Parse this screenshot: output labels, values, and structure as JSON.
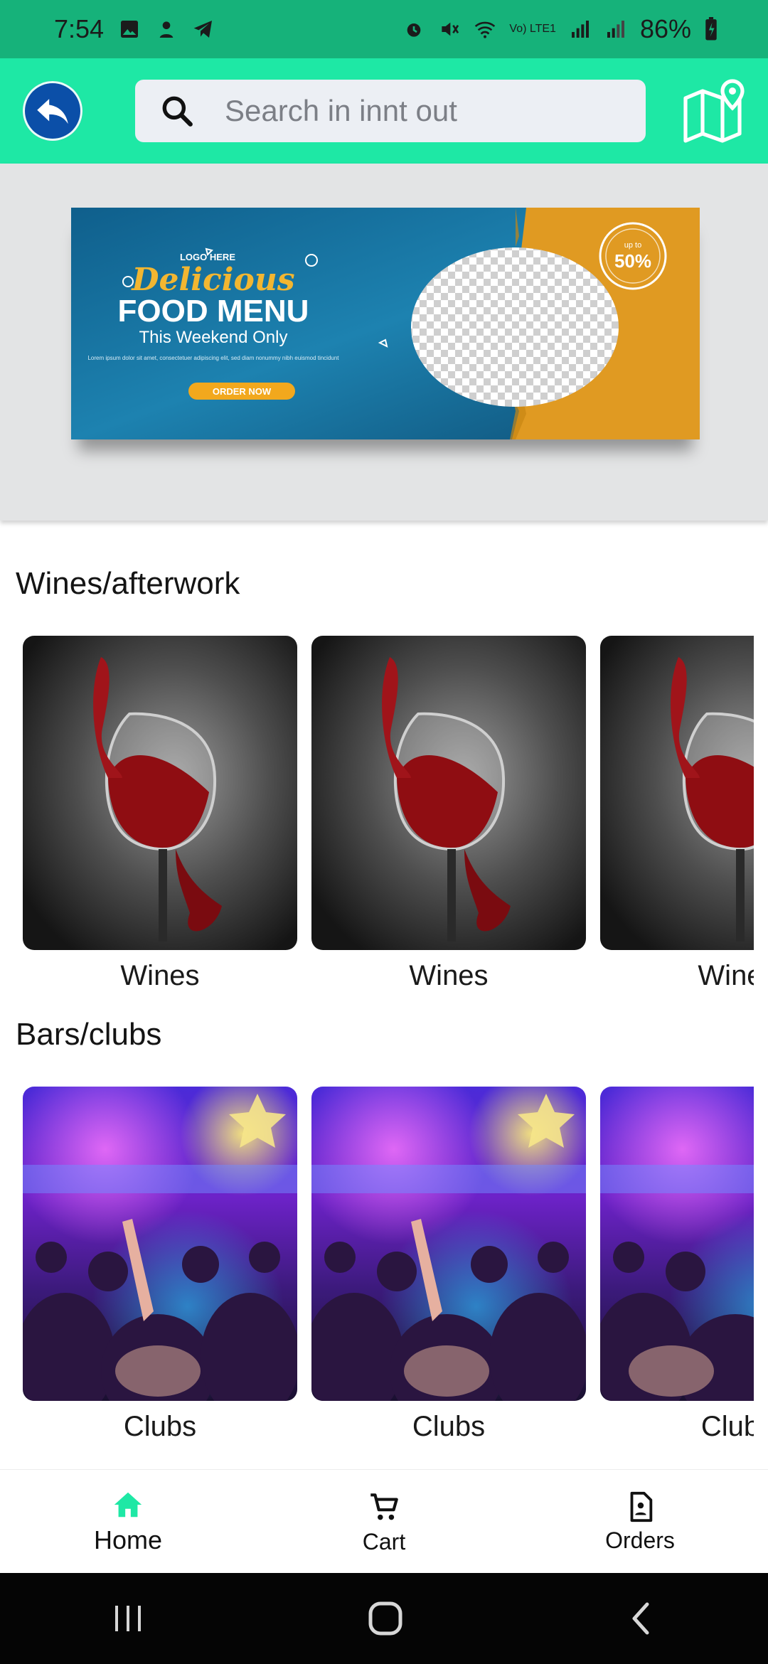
{
  "status_bar": {
    "time": "7:54",
    "network": "Vo) LTE1",
    "battery": "86%"
  },
  "header": {
    "search_placeholder": "Search in innt out"
  },
  "banner": {
    "logo_text": "LOGO HERE",
    "script_title": "Delicious",
    "title": "FOOD MENU",
    "subtitle": "This Weekend Only",
    "body": "Lorem ipsum dolor sit amet, consectetuer adipiscing elit, sed diam nonummy nibh euismod tincidunt",
    "cta": "ORDER NOW",
    "badge_top": "up to",
    "badge_value": "50%"
  },
  "sections": [
    {
      "title": "Wines/afterwork",
      "items": [
        {
          "label": "Wines"
        },
        {
          "label": "Wines"
        },
        {
          "label": "Wines"
        }
      ]
    },
    {
      "title": "Bars/clubs",
      "items": [
        {
          "label": "Clubs"
        },
        {
          "label": "Clubs"
        },
        {
          "label": "Clubs"
        }
      ]
    }
  ],
  "bottom_nav": [
    {
      "label": "Home",
      "icon": "home-icon",
      "active": true
    },
    {
      "label": "Cart",
      "icon": "cart-icon",
      "active": false
    },
    {
      "label": "Orders",
      "icon": "orders-icon",
      "active": false
    }
  ],
  "colors": {
    "status_bar": "#16b27a",
    "app_bar": "#1ee8a5",
    "back_button": "#0b4fa8",
    "active_nav": "#1ee8a5"
  }
}
